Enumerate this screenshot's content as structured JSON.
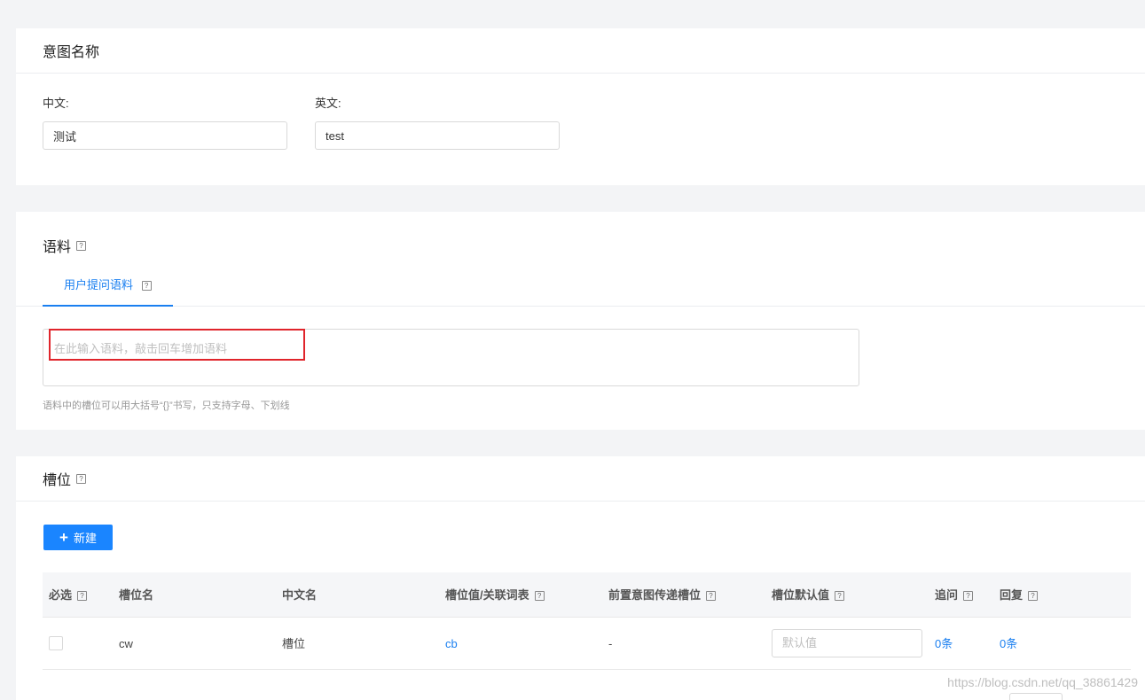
{
  "intent": {
    "title": "意图名称",
    "zh_label": "中文:",
    "zh_value": "测试",
    "en_label": "英文:",
    "en_value": "test"
  },
  "corpus": {
    "title": "语料",
    "tab_label": "用户提问语料",
    "placeholder": "在此输入语料，敲击回车增加语料",
    "hint": "语料中的槽位可以用大括号“{}”书写，只支持字母、下划线"
  },
  "slots": {
    "title": "槽位",
    "new_button": "新建",
    "columns": [
      "必选",
      "槽位名",
      "中文名",
      "槽位值/关联词表",
      "前置意图传递槽位",
      "槽位默认值",
      "追问",
      "回复"
    ],
    "rows": [
      {
        "required": false,
        "name": "cw",
        "chinese_name": "槽位",
        "values": "cb",
        "prev_intent_slot": "-",
        "default_placeholder": "默认值",
        "follow_up": "0条",
        "reply": "0条"
      }
    ]
  },
  "watermark": "https://blog.csdn.net/qq_38861429"
}
